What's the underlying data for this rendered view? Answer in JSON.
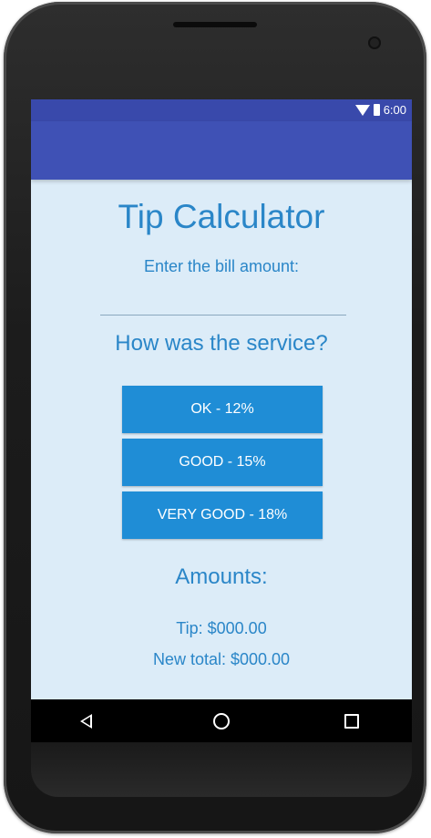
{
  "status_bar": {
    "time": "6:00",
    "wifi_icon": "wifi-icon",
    "battery_icon": "battery-icon"
  },
  "main": {
    "title": "Tip Calculator",
    "bill_prompt": "Enter the bill amount:",
    "bill_input_value": "",
    "service_question": "How was the service?",
    "buttons": {
      "ok": "OK - 12%",
      "good": "GOOD - 15%",
      "very_good": "VERY GOOD - 18%"
    },
    "amounts_heading": "Amounts:",
    "tip_text": "Tip: $000.00",
    "total_text": "New total: $000.00"
  },
  "nav_bar": {
    "back_icon": "back-triangle-icon",
    "home_icon": "home-circle-icon",
    "recent_icon": "recent-apps-square-icon"
  },
  "colors": {
    "app_bar": "#3f51b5",
    "status_bar": "#3949ab",
    "background": "#dcecf8",
    "accent_text": "#2a86c8",
    "button": "#1f8dd6"
  }
}
